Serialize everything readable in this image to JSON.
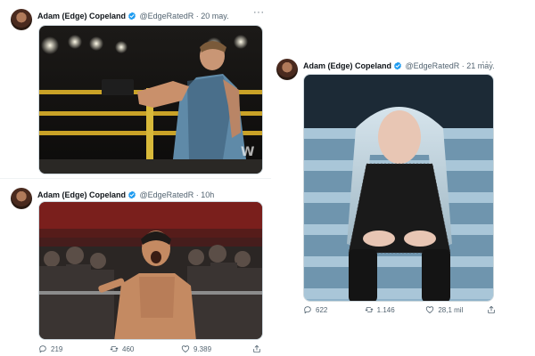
{
  "colors": {
    "verified": "#1d9bf0",
    "muted": "#536471",
    "text": "#0f1419"
  },
  "tweets": [
    {
      "author": "Adam (Edge) Copeland",
      "handle": "@EdgeRatedR",
      "separator": "·",
      "time": "20 may.",
      "more": "···",
      "media": "photo of a wrestler in a denim vest posing on the ring ropes under arena lights"
    },
    {
      "author": "Adam (Edge) Copeland",
      "handle": "@EdgeRatedR",
      "separator": "·",
      "time": "10h",
      "more": "···",
      "media": "photo of a shirtless wrestler shouting in front of a crowd",
      "replies": "219",
      "retweets": "460",
      "likes": "9.389"
    },
    {
      "author": "Adam (Edge) Copeland",
      "handle": "@EdgeRatedR",
      "separator": "·",
      "time": "21 may.",
      "more": "···",
      "media": "photo of a woman with long silver hair and fishnet sleeves seated on stadium steps",
      "replies": "622",
      "retweets": "1.146",
      "likes": "28,1 mil"
    }
  ],
  "icons": [
    "verified-badge-icon",
    "more-icon",
    "reply-icon",
    "retweet-icon",
    "like-icon",
    "share-icon"
  ]
}
